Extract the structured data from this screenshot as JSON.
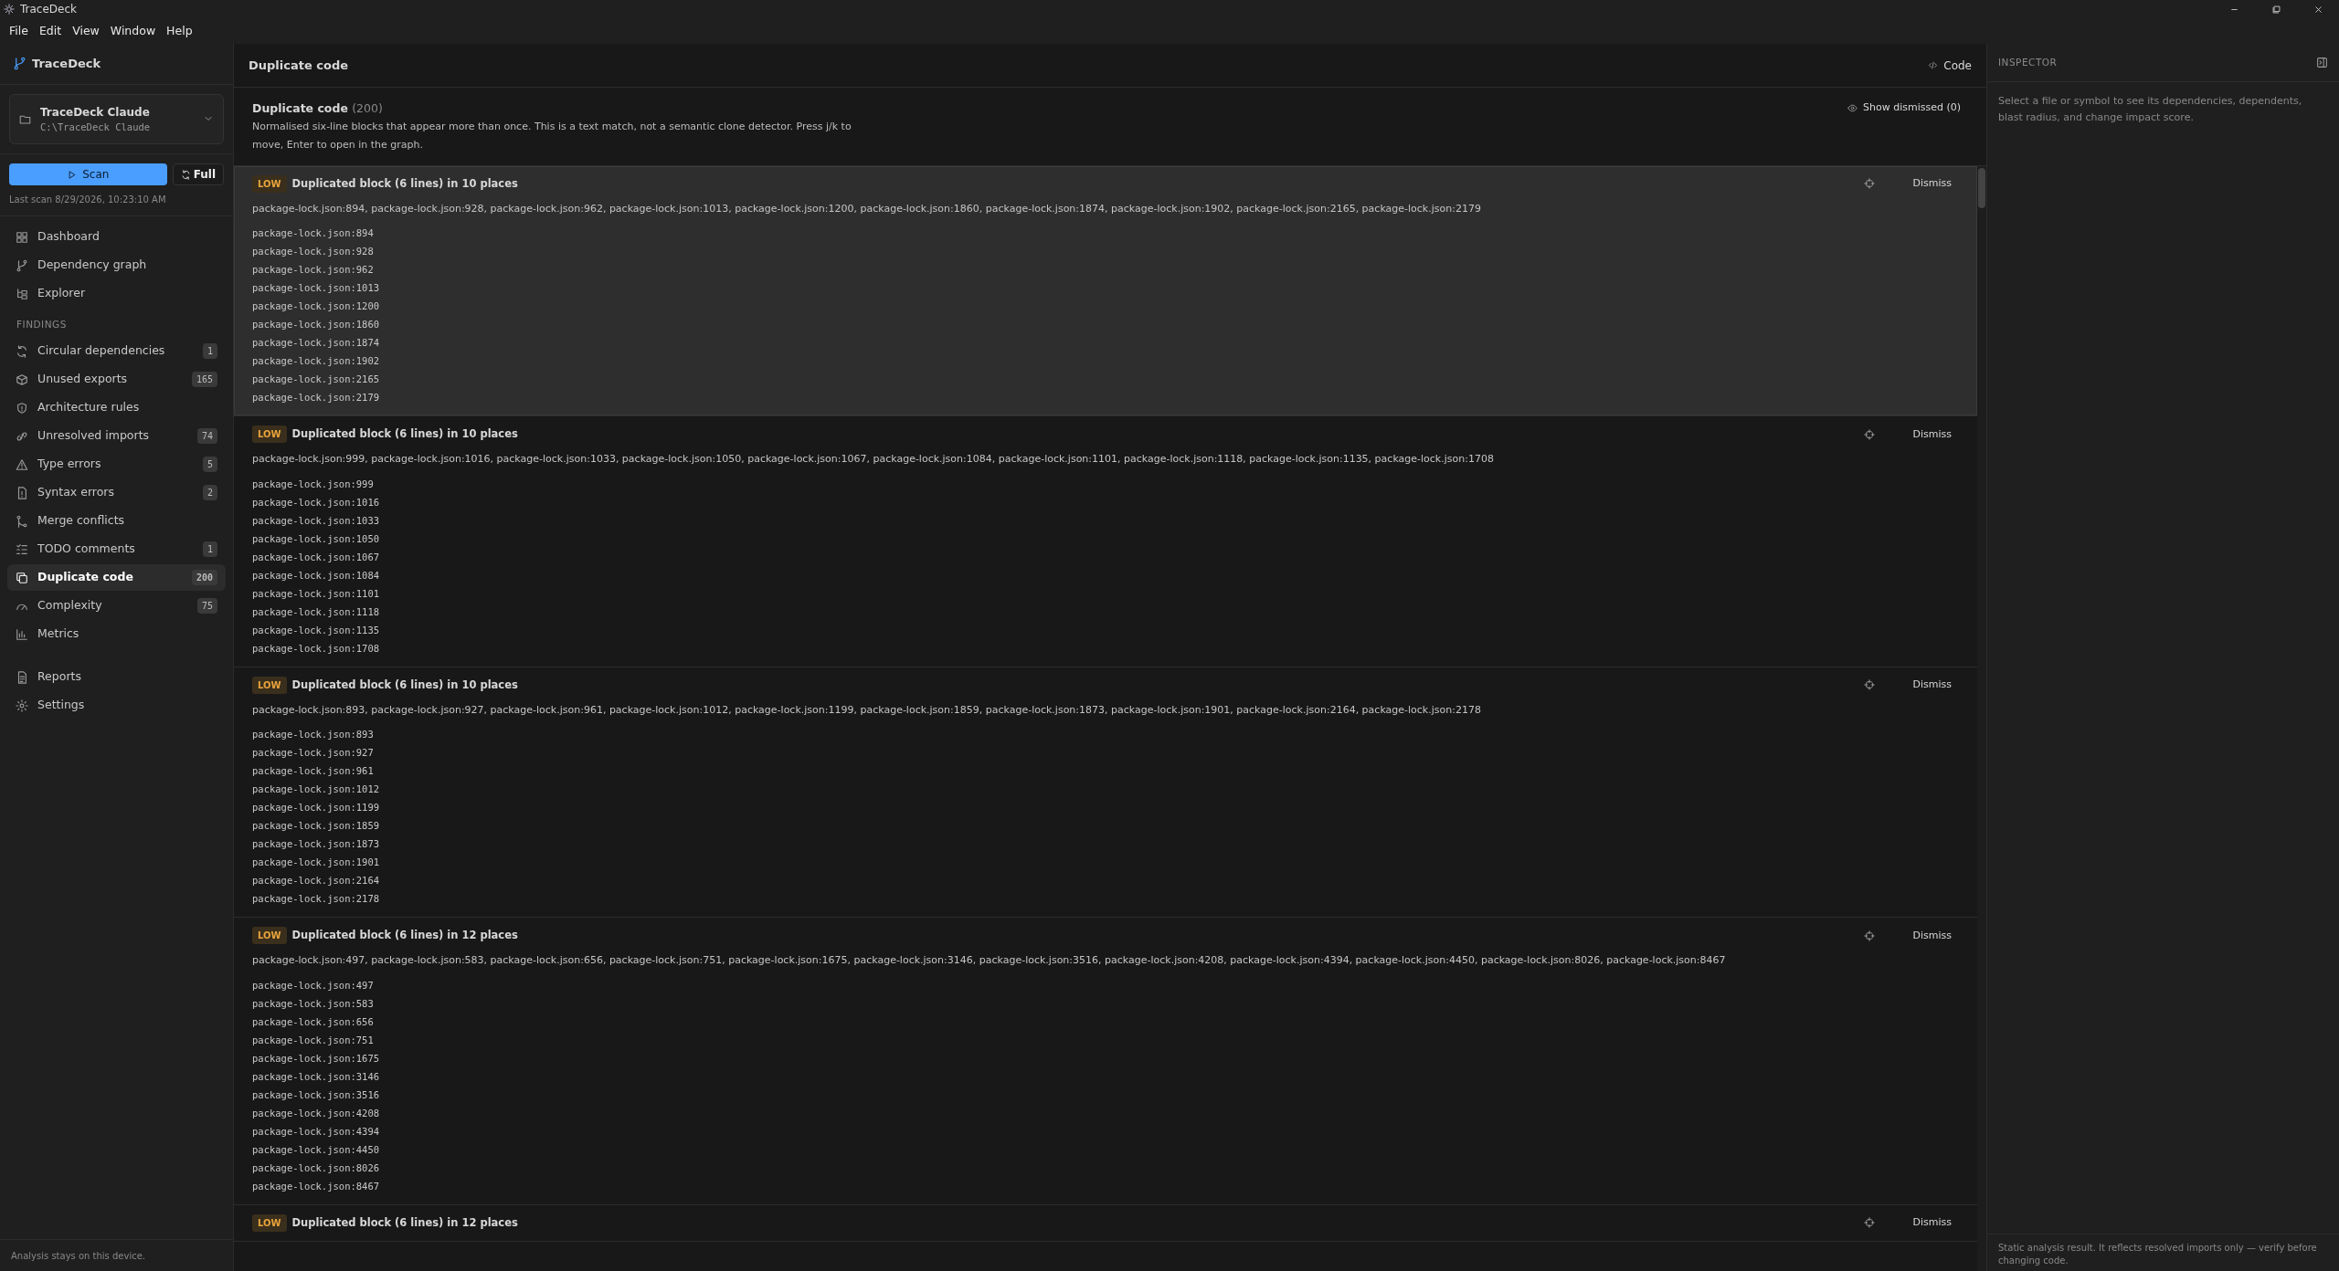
{
  "window": {
    "title": "TraceDeck"
  },
  "menu": [
    "File",
    "Edit",
    "View",
    "Window",
    "Help"
  ],
  "sidebar": {
    "brand": "TraceDeck",
    "project": {
      "name": "TraceDeck Claude",
      "path": "C:\\TraceDeck Claude"
    },
    "scan_button": "Scan",
    "full_button": "Full",
    "last_scan": "Last scan 8/29/2026, 10:23:10 AM",
    "nav_top": [
      {
        "label": "Dashboard",
        "selected": false
      },
      {
        "label": "Dependency graph",
        "selected": false
      },
      {
        "label": "Explorer",
        "selected": false
      }
    ],
    "findings_heading": "FINDINGS",
    "findings": [
      {
        "label": "Circular dependencies",
        "count": "1",
        "selected": false
      },
      {
        "label": "Unused exports",
        "count": "165",
        "selected": false
      },
      {
        "label": "Architecture rules",
        "selected": false
      },
      {
        "label": "Unresolved imports",
        "count": "74",
        "selected": false
      },
      {
        "label": "Type errors",
        "count": "5",
        "selected": false
      },
      {
        "label": "Syntax errors",
        "count": "2",
        "selected": false
      },
      {
        "label": "Merge conflicts",
        "selected": false
      },
      {
        "label": "TODO comments",
        "count": "1",
        "selected": false
      },
      {
        "label": "Duplicate code",
        "count": "200",
        "selected": true
      },
      {
        "label": "Complexity",
        "count": "75",
        "selected": false
      },
      {
        "label": "Metrics",
        "selected": false
      }
    ],
    "nav_bottom": [
      {
        "label": "Reports",
        "selected": false
      },
      {
        "label": "Settings",
        "selected": false
      }
    ],
    "footer": "Analysis stays on this device."
  },
  "main": {
    "title": "Duplicate code",
    "code_button": "Code",
    "intro": {
      "title": "Duplicate code",
      "count": "(200)",
      "description": "Normalised six-line blocks that appear more than once. This is a text match, not a semantic clone detector. Press j/k to move, Enter to open in the graph.",
      "show_dismissed": "Show dismissed (0)"
    },
    "results": [
      {
        "severity": "LOW",
        "title": "Duplicated block (6 lines) in 10 places",
        "selected": true,
        "dismiss": "Dismiss",
        "summary": "package-lock.json:894, package-lock.json:928, package-lock.json:962, package-lock.json:1013, package-lock.json:1200, package-lock.json:1860, package-lock.json:1874, package-lock.json:1902, package-lock.json:2165, package-lock.json:2179",
        "locations": [
          "package-lock.json:894",
          "package-lock.json:928",
          "package-lock.json:962",
          "package-lock.json:1013",
          "package-lock.json:1200",
          "package-lock.json:1860",
          "package-lock.json:1874",
          "package-lock.json:1902",
          "package-lock.json:2165",
          "package-lock.json:2179"
        ]
      },
      {
        "severity": "LOW",
        "title": "Duplicated block (6 lines) in 10 places",
        "selected": false,
        "dismiss": "Dismiss",
        "summary": "package-lock.json:999, package-lock.json:1016, package-lock.json:1033, package-lock.json:1050, package-lock.json:1067, package-lock.json:1084, package-lock.json:1101, package-lock.json:1118, package-lock.json:1135, package-lock.json:1708",
        "locations": [
          "package-lock.json:999",
          "package-lock.json:1016",
          "package-lock.json:1033",
          "package-lock.json:1050",
          "package-lock.json:1067",
          "package-lock.json:1084",
          "package-lock.json:1101",
          "package-lock.json:1118",
          "package-lock.json:1135",
          "package-lock.json:1708"
        ]
      },
      {
        "severity": "LOW",
        "title": "Duplicated block (6 lines) in 10 places",
        "selected": false,
        "dismiss": "Dismiss",
        "summary": "package-lock.json:893, package-lock.json:927, package-lock.json:961, package-lock.json:1012, package-lock.json:1199, package-lock.json:1859, package-lock.json:1873, package-lock.json:1901, package-lock.json:2164, package-lock.json:2178",
        "locations": [
          "package-lock.json:893",
          "package-lock.json:927",
          "package-lock.json:961",
          "package-lock.json:1012",
          "package-lock.json:1199",
          "package-lock.json:1859",
          "package-lock.json:1873",
          "package-lock.json:1901",
          "package-lock.json:2164",
          "package-lock.json:2178"
        ]
      },
      {
        "severity": "LOW",
        "title": "Duplicated block (6 lines) in 12 places",
        "selected": false,
        "dismiss": "Dismiss",
        "summary": "package-lock.json:497, package-lock.json:583, package-lock.json:656, package-lock.json:751, package-lock.json:1675, package-lock.json:3146, package-lock.json:3516, package-lock.json:4208, package-lock.json:4394, package-lock.json:4450, package-lock.json:8026, package-lock.json:8467",
        "locations": [
          "package-lock.json:497",
          "package-lock.json:583",
          "package-lock.json:656",
          "package-lock.json:751",
          "package-lock.json:1675",
          "package-lock.json:3146",
          "package-lock.json:3516",
          "package-lock.json:4208",
          "package-lock.json:4394",
          "package-lock.json:4450",
          "package-lock.json:8026",
          "package-lock.json:8467"
        ]
      },
      {
        "severity": "LOW",
        "title": "Duplicated block (6 lines) in 12 places",
        "selected": false,
        "dismiss": "Dismiss"
      }
    ]
  },
  "inspector": {
    "title": "INSPECTOR",
    "hint": "Select a file or symbol to see its dependencies, dependents, blast radius, and change impact score.",
    "footer": "Static analysis result. It reflects resolved imports only — verify before changing code."
  }
}
